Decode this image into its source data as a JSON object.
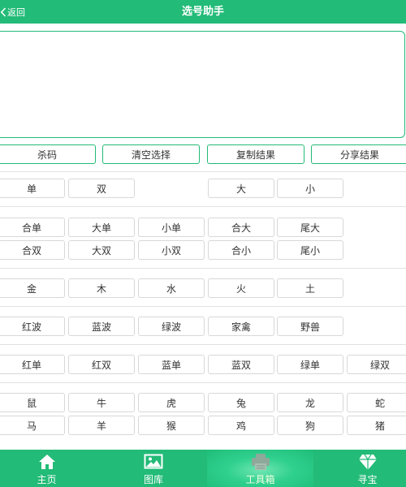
{
  "header": {
    "back_label": "返回",
    "title": "选号助手"
  },
  "result_text": "",
  "actions": [
    "杀码",
    "清空选择",
    "复制结果",
    "分享结果"
  ],
  "groups": {
    "odd_even": [
      "单",
      "双"
    ],
    "big_small": [
      "大",
      "小"
    ],
    "combo_row1": [
      "合单",
      "大单",
      "小单",
      "合大",
      "尾大"
    ],
    "combo_row2": [
      "合双",
      "大双",
      "小双",
      "合小",
      "尾小"
    ],
    "elements": [
      "金",
      "木",
      "水",
      "火",
      "土"
    ],
    "waves": [
      "红波",
      "蓝波",
      "绿波",
      "家禽",
      "野兽"
    ],
    "wave_parity": [
      "红单",
      "红双",
      "蓝单",
      "蓝双",
      "绿单",
      "绿双"
    ],
    "zodiac_row1": [
      "鼠",
      "牛",
      "虎",
      "兔",
      "龙",
      "蛇"
    ],
    "zodiac_row2": [
      "马",
      "羊",
      "猴",
      "鸡",
      "狗",
      "猪"
    ]
  },
  "tabs": [
    {
      "label": "主页",
      "icon": "home-icon"
    },
    {
      "label": "图库",
      "icon": "image-icon"
    },
    {
      "label": "工具箱",
      "icon": "toolbox-icon",
      "active": true
    },
    {
      "label": "寻宝",
      "icon": "diamond-icon"
    }
  ],
  "colors": {
    "primary": "#22bb77",
    "active_tab": "#2fd08f",
    "border": "#d8d8d8"
  }
}
